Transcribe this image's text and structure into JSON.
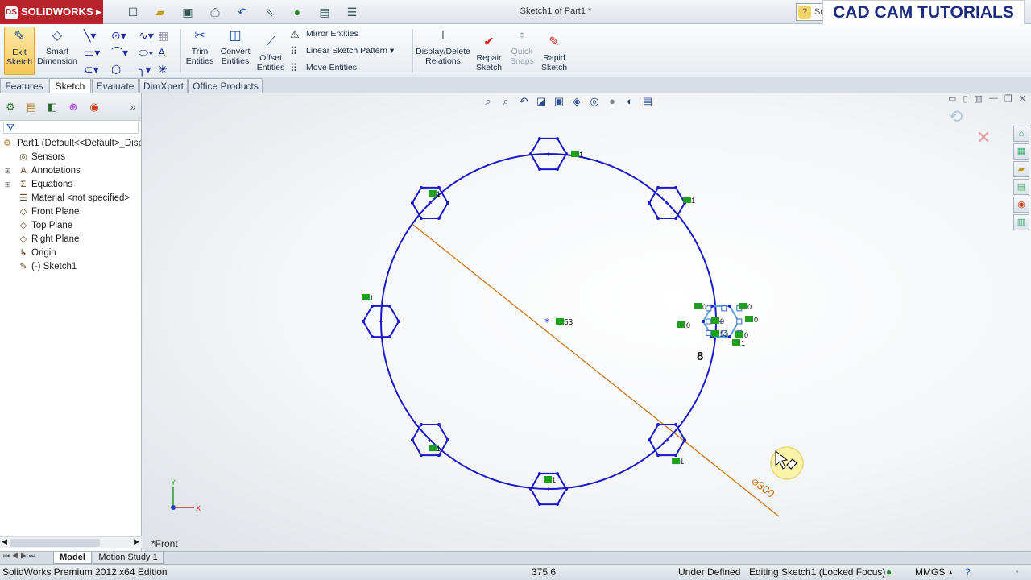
{
  "app": {
    "brand": "SOLIDWORKS",
    "document_title": "Sketch1 of Part1 *",
    "search_placeholder": "Se",
    "watermark": "CAD CAM TUTORIALS"
  },
  "ribbon": {
    "exit_sketch": "Exit Sketch",
    "smart_dimension": "Smart Dimension",
    "trim_entities": "Trim Entities",
    "convert_entities": "Convert Entities",
    "offset_entities": "Offset Entities",
    "mirror_entities": "Mirror Entities",
    "linear_sketch_pattern": "Linear Sketch Pattern",
    "move_entities": "Move Entities",
    "display_delete_relations": "Display/Delete Relations",
    "repair_sketch": "Repair Sketch",
    "quick_snaps": "Quick Snaps",
    "rapid_sketch": "Rapid Sketch"
  },
  "tabs": [
    {
      "label": "Features",
      "active": false
    },
    {
      "label": "Sketch",
      "active": true
    },
    {
      "label": "Evaluate",
      "active": false
    },
    {
      "label": "DimXpert",
      "active": false
    },
    {
      "label": "Office Products",
      "active": false
    }
  ],
  "tree": {
    "root": "Part1  (Default<<Default>_Disp",
    "items": [
      {
        "label": "Sensors",
        "icon": "sensor-icon",
        "expandable": false
      },
      {
        "label": "Annotations",
        "icon": "annotation-icon",
        "expandable": true
      },
      {
        "label": "Equations",
        "icon": "equation-icon",
        "expandable": true
      },
      {
        "label": "Material <not specified>",
        "icon": "material-icon",
        "expandable": false
      },
      {
        "label": "Front Plane",
        "icon": "plane-icon",
        "expandable": false
      },
      {
        "label": "Top Plane",
        "icon": "plane-icon",
        "expandable": false
      },
      {
        "label": "Right Plane",
        "icon": "plane-icon",
        "expandable": false
      },
      {
        "label": "Origin",
        "icon": "origin-icon",
        "expandable": false
      },
      {
        "label": "(-) Sketch1",
        "icon": "sketch-icon",
        "expandable": false
      }
    ]
  },
  "sketch": {
    "view_label": "*Front",
    "diameter_dimension": "⌀300",
    "hexagon_count_label": "8",
    "center_relation_tag": "53",
    "hexagon_relation_tag": "1",
    "selected_relation_tags": [
      "0",
      "0",
      "0",
      "0",
      "0",
      "0",
      "1",
      "53"
    ],
    "axis_x": "X",
    "axis_y": "Y",
    "sketch_color": "#1a1ac8",
    "dimension_color": "#c87818",
    "relation_color": "#1ea01e"
  },
  "bottom_tabs": [
    {
      "label": "Model",
      "active": true
    },
    {
      "label": "Motion Study 1",
      "active": false
    }
  ],
  "status": {
    "edition": "SolidWorks Premium 2012 x64 Edition",
    "coordinate": "375.6",
    "definition": "Under Defined",
    "editing": "Editing Sketch1 (Locked Focus)",
    "units": "MMGS"
  }
}
